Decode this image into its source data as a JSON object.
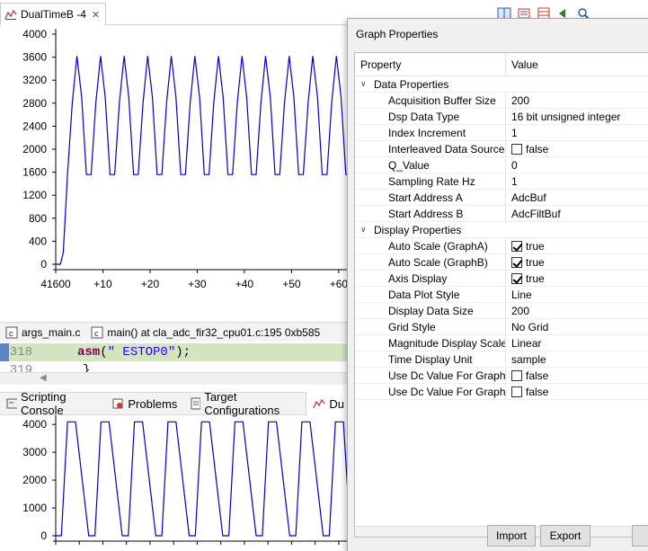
{
  "editor_tab": {
    "label": "DualTimeB -4"
  },
  "chart_data": [
    {
      "type": "line",
      "title": "",
      "x_tick_labels": [
        "41600",
        "+10",
        "+20",
        "+30",
        "+40",
        "+50",
        "+60"
      ],
      "y_tick_labels": [
        "0",
        "400",
        "800",
        "1200",
        "1600",
        "2000",
        "2400",
        "2800",
        "3200",
        "3600",
        "4000"
      ],
      "ylim": [
        0,
        4000
      ],
      "x": [
        0,
        1,
        1.6,
        2.5,
        3.5,
        4.5,
        5.5,
        6.5,
        7.5,
        8.5,
        9.5,
        10.5,
        11.5,
        12.5,
        13.5,
        14.5,
        15.5,
        16.5,
        17.5,
        18.5,
        19.5,
        20.5,
        21.5,
        22.5,
        23.5,
        24.5,
        25.5,
        26.5,
        27.5,
        28.5,
        29.5,
        30.5,
        31.5,
        32.5,
        33.5,
        34.5,
        35.5,
        36.5,
        37.5,
        38.5,
        39.5,
        40.5,
        41.5,
        42.5,
        43.5,
        44.5,
        45.5,
        46.5,
        47.5,
        48.5,
        49.5,
        50.5,
        51.5,
        52.5,
        53.5,
        54.5,
        55.5,
        56.5,
        57.5,
        58.5,
        59.5,
        60.5,
        61.5,
        62.5
      ],
      "y": [
        0,
        0,
        200,
        1560,
        2800,
        3620,
        2900,
        1560,
        1560,
        2800,
        3620,
        2900,
        1560,
        1560,
        2800,
        3620,
        2900,
        1560,
        1560,
        2800,
        3620,
        2900,
        1560,
        1560,
        2800,
        3620,
        2900,
        1560,
        1560,
        2800,
        3620,
        2900,
        1560,
        1560,
        2800,
        3620,
        2900,
        1560,
        1560,
        2800,
        3620,
        2900,
        1560,
        1560,
        2800,
        3620,
        2900,
        1560,
        1560,
        2800,
        3620,
        2900,
        1560,
        1560,
        2800,
        3620,
        2900,
        1560,
        1560,
        2800,
        3620,
        2900,
        1560,
        1560
      ],
      "color": "#0000cc"
    },
    {
      "type": "line",
      "title": "",
      "y_tick_labels": [
        "0",
        "1000",
        "2000",
        "3000",
        "4000"
      ],
      "ylim": [
        0,
        4200
      ],
      "x": [
        0,
        1.2,
        2.5,
        4.2,
        7.0,
        8.3,
        9.6,
        11.3,
        14.1,
        15.4,
        16.7,
        18.4,
        21.2,
        22.5,
        23.8,
        25.5,
        28.3,
        29.6,
        30.9,
        32.6,
        35.4,
        36.7,
        38.0,
        39.7,
        42.5,
        43.8,
        45.1,
        46.8,
        49.6,
        50.9,
        52.2,
        53.9,
        56.7,
        58.0,
        59.3,
        61.0,
        62.5
      ],
      "y": [
        0,
        0,
        4095,
        4095,
        0,
        0,
        4095,
        4095,
        0,
        0,
        4095,
        4095,
        0,
        0,
        4095,
        4095,
        0,
        0,
        4095,
        4095,
        0,
        0,
        4095,
        4095,
        0,
        0,
        4095,
        4095,
        0,
        0,
        4095,
        4095,
        0,
        0,
        4095,
        4095,
        0
      ],
      "color": "#0000cc"
    }
  ],
  "editor": {
    "tabs": [
      {
        "label": "args_main.c"
      },
      {
        "label": "main() at cla_adc_fir32_cpu01.c:195 0xb585"
      }
    ],
    "lines": [
      {
        "number": "318",
        "keyword": "asm",
        "text_open": "(",
        "string": "\" ESTOP0\"",
        "text_close": ");"
      },
      {
        "number": "319",
        "text": "}"
      }
    ]
  },
  "bottom_tabs": [
    {
      "label": "Scripting Console"
    },
    {
      "label": "Problems"
    },
    {
      "label": "Target Configurations"
    },
    {
      "label": "Du"
    }
  ],
  "dialog": {
    "title": "Graph Properties",
    "header": {
      "property": "Property",
      "value": "Value"
    },
    "categories": [
      {
        "label": "Data Properties",
        "rows": [
          {
            "name": "Acquisition Buffer Size",
            "value": "200"
          },
          {
            "name": "Dsp Data Type",
            "value": "16 bit unsigned integer"
          },
          {
            "name": "Index Increment",
            "value": "1"
          },
          {
            "name": "Interleaved Data Sources",
            "value": "false",
            "checkbox": true,
            "checked": false
          },
          {
            "name": "Q_Value",
            "value": "0"
          },
          {
            "name": "Sampling Rate Hz",
            "value": "1"
          },
          {
            "name": "Start Address A",
            "value": "AdcBuf"
          },
          {
            "name": "Start Address B",
            "value": "AdcFiltBuf"
          }
        ]
      },
      {
        "label": "Display Properties",
        "rows": [
          {
            "name": "Auto Scale (GraphA)",
            "value": "true",
            "checkbox": true,
            "checked": true
          },
          {
            "name": "Auto Scale (GraphB)",
            "value": "true",
            "checkbox": true,
            "checked": true
          },
          {
            "name": "Axis Display",
            "value": "true",
            "checkbox": true,
            "checked": true
          },
          {
            "name": "Data Plot Style",
            "value": "Line"
          },
          {
            "name": "Display Data Size",
            "value": "200"
          },
          {
            "name": "Grid Style",
            "value": "No Grid"
          },
          {
            "name": "Magnitude Display Scale",
            "value": "Linear"
          },
          {
            "name": "Time Display Unit",
            "value": "sample"
          },
          {
            "name": "Use Dc Value For Graph A",
            "value": "false",
            "checkbox": true,
            "checked": false
          },
          {
            "name": "Use Dc Value For Graph B",
            "value": "false",
            "checkbox": true,
            "checked": false
          }
        ]
      }
    ],
    "buttons": {
      "import": "Import",
      "export": "Export"
    }
  }
}
